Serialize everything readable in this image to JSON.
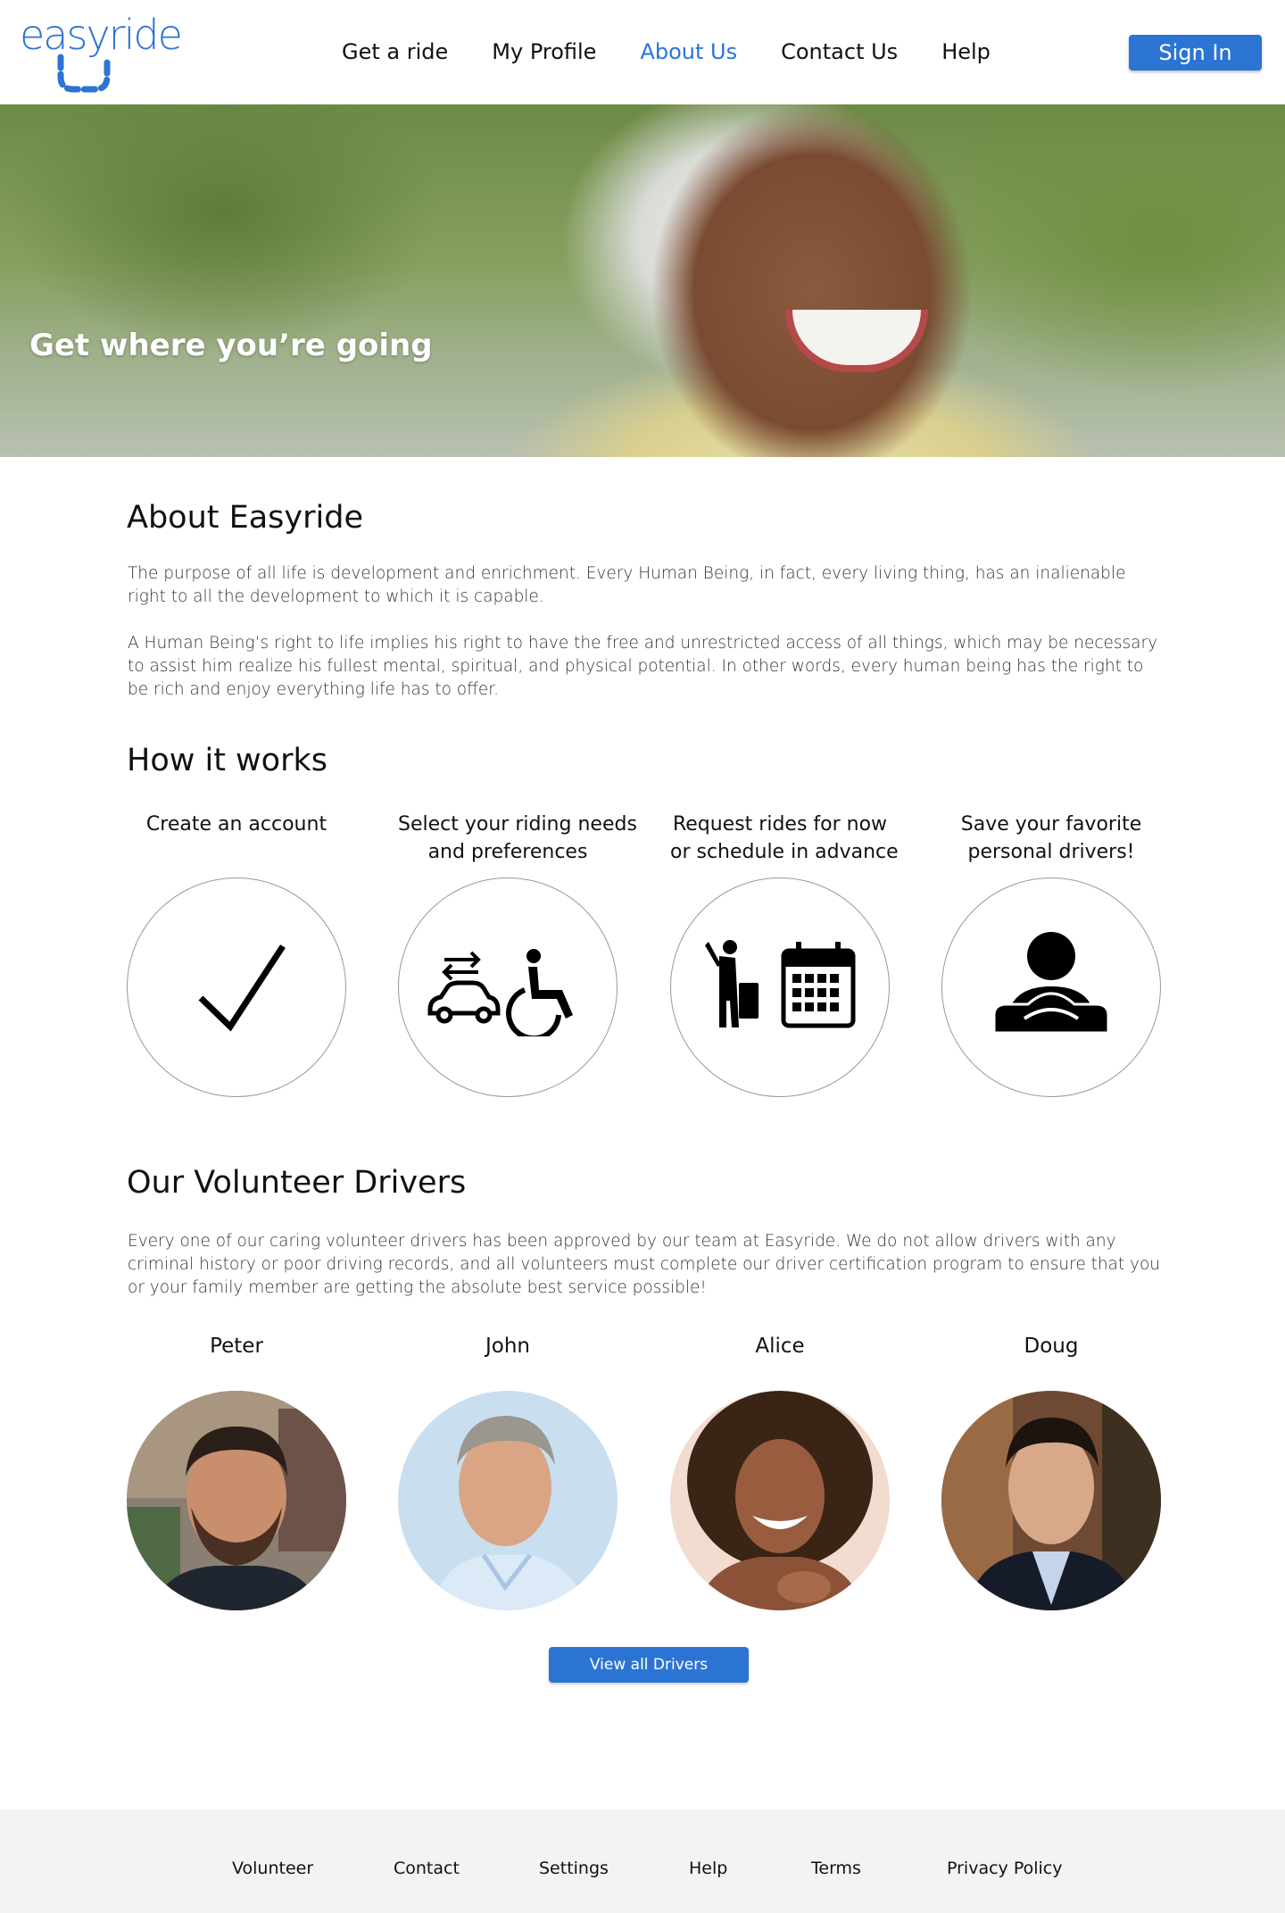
{
  "header": {
    "logo_text": "easyride",
    "nav": [
      {
        "label": "Get a ride",
        "active": false
      },
      {
        "label": "My Profile",
        "active": false
      },
      {
        "label": "About Us",
        "active": true
      },
      {
        "label": "Contact Us",
        "active": false
      },
      {
        "label": "Help",
        "active": false
      }
    ],
    "signin_label": "Sign In"
  },
  "hero": {
    "title": "Get where you’re going"
  },
  "about": {
    "heading": "About Easyride",
    "paragraphs": [
      "The purpose of all life is development and enrichment. Every Human Being, in fact, every living thing, has an inalienable right to all the development to which it is capable.",
      "A Human Being’s right to life implies his right to have the free and unrestricted access of all things, which may be necessary to assist him realize his fullest mental, spiritual, and physical potential. In other words, every human being has the right to be rich and enjoy everything life has to offer."
    ]
  },
  "how_it_works": {
    "heading": "How it works",
    "steps": [
      {
        "line1": "Create an account",
        "line2": "",
        "icon": "checkmark-icon"
      },
      {
        "line1": "Select your riding needs",
        "line2": "and preferences",
        "icon": "car-wheelchair-icon"
      },
      {
        "line1": "Request rides for now",
        "line2": "or schedule in advance",
        "icon": "traveler-calendar-icon"
      },
      {
        "line1": "Save your favorite",
        "line2": "personal drivers!",
        "icon": "driver-icon"
      }
    ]
  },
  "drivers": {
    "heading": "Our Volunteer Drivers",
    "description": "Every one of our caring volunteer drivers has been approved by our team at Easyride.  We do not allow drivers with any criminal history or poor driving records, and all volunteers must complete our driver certification program to ensure that you or your family member are getting the absolute best service possible!",
    "list": [
      {
        "name": "Peter"
      },
      {
        "name": "John"
      },
      {
        "name": "Alice"
      },
      {
        "name": "Doug"
      }
    ],
    "view_all_label": "View all Drivers"
  },
  "footer": {
    "links": [
      "Volunteer",
      "Contact",
      "Settings",
      "Help",
      "Terms",
      "Privacy Policy"
    ]
  },
  "colors": {
    "accent": "#2c74d4",
    "footer_bg": "#f3f3f3"
  }
}
